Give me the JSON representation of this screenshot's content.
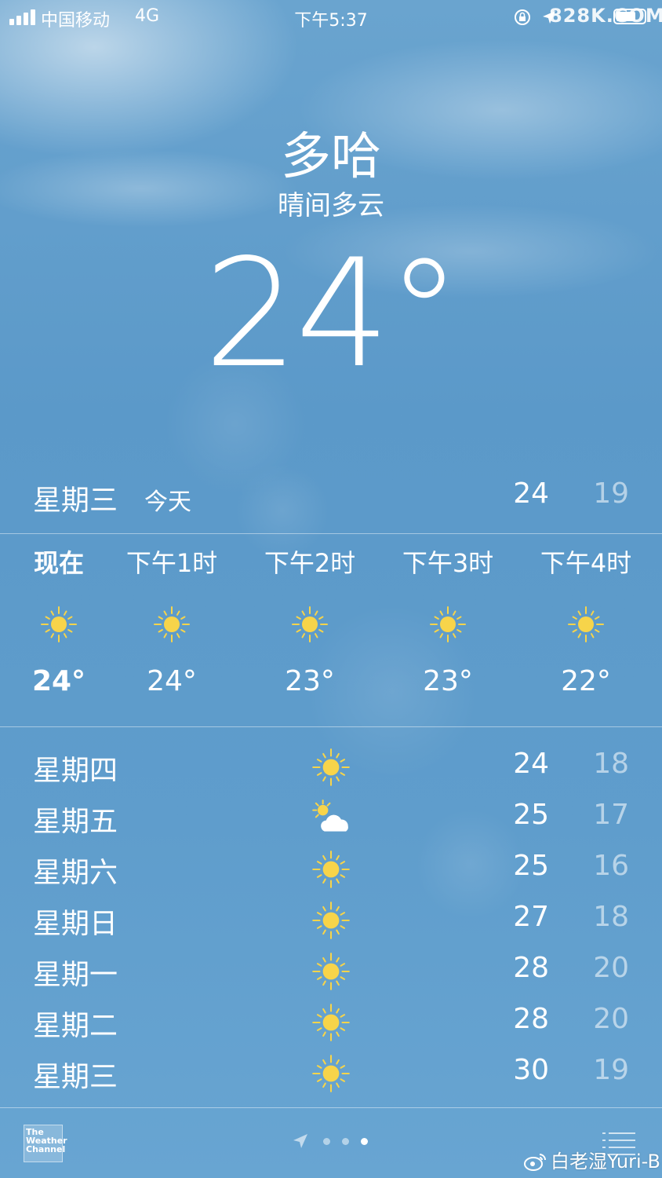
{
  "status_bar": {
    "carrier": "中国移动",
    "network": "4G",
    "time": "下午5:37",
    "watermark": "828K.COM"
  },
  "location": {
    "city": "多哈",
    "condition": "晴间多云",
    "temperature": "24°"
  },
  "today": {
    "day": "星期三",
    "label": "今天",
    "high": "24",
    "low": "19"
  },
  "hourly": [
    {
      "time": "现在",
      "icon": "sun-icon",
      "temp": "24°"
    },
    {
      "time": "下午1时",
      "icon": "sun-icon",
      "temp": "24°"
    },
    {
      "time": "下午2时",
      "icon": "sun-icon",
      "temp": "23°"
    },
    {
      "time": "下午3时",
      "icon": "sun-icon",
      "temp": "23°"
    },
    {
      "time": "下午4时",
      "icon": "sun-icon",
      "temp": "22°"
    }
  ],
  "daily": [
    {
      "day": "星期四",
      "icon": "sun-icon",
      "high": "24",
      "low": "18"
    },
    {
      "day": "星期五",
      "icon": "partly-cloudy-icon",
      "high": "25",
      "low": "17"
    },
    {
      "day": "星期六",
      "icon": "sun-icon",
      "high": "25",
      "low": "16"
    },
    {
      "day": "星期日",
      "icon": "sun-icon",
      "high": "27",
      "low": "18"
    },
    {
      "day": "星期一",
      "icon": "sun-icon",
      "high": "28",
      "low": "20"
    },
    {
      "day": "星期二",
      "icon": "sun-icon",
      "high": "28",
      "low": "20"
    },
    {
      "day": "星期三",
      "icon": "sun-icon",
      "high": "30",
      "low": "19"
    }
  ],
  "footer": {
    "logo_text": [
      "The",
      "Weather",
      "Channel"
    ],
    "weibo_watermark": "白老湿Yuri-B"
  },
  "colors": {
    "sun": "#f7d44a",
    "sky": "#5f9dcc"
  }
}
